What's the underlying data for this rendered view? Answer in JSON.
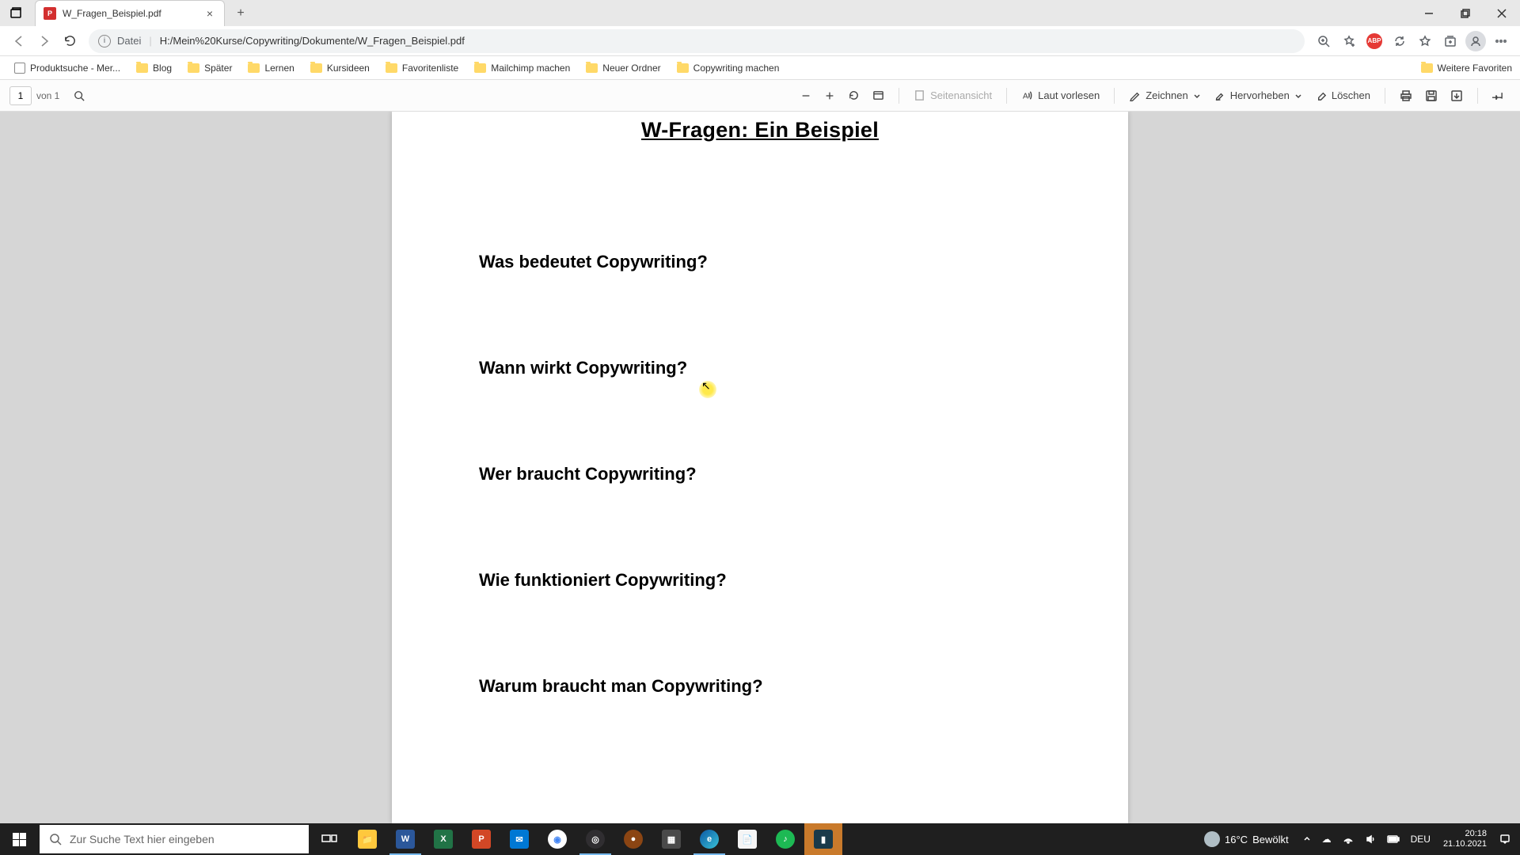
{
  "tab": {
    "title": "W_Fragen_Beispiel.pdf"
  },
  "url": {
    "scheme_label": "Datei",
    "path": "H:/Mein%20Kurse/Copywriting/Dokumente/W_Fragen_Beispiel.pdf"
  },
  "bookmarks": [
    {
      "label": "Produktsuche - Mer...",
      "icon": "page"
    },
    {
      "label": "Blog",
      "icon": "folder"
    },
    {
      "label": "Später",
      "icon": "folder"
    },
    {
      "label": "Lernen",
      "icon": "folder"
    },
    {
      "label": "Kursideen",
      "icon": "folder"
    },
    {
      "label": "Favoritenliste",
      "icon": "folder"
    },
    {
      "label": "Mailchimp machen",
      "icon": "folder"
    },
    {
      "label": "Neuer Ordner",
      "icon": "folder"
    },
    {
      "label": "Copywriting machen",
      "icon": "folder"
    }
  ],
  "more_bookmarks_label": "Weitere Favoriten",
  "pdf_toolbar": {
    "page_current": "1",
    "page_of": "von 1",
    "page_view": "Seitenansicht",
    "read_aloud": "Laut vorlesen",
    "draw": "Zeichnen",
    "highlight": "Hervorheben",
    "erase": "Löschen"
  },
  "document": {
    "title": "W-Fragen: Ein Beispiel",
    "questions": [
      "Was bedeutet Copywriting?",
      "Wann wirkt Copywriting?",
      "Wer braucht Copywriting?",
      "Wie funktioniert Copywriting?",
      "Warum braucht man Copywriting?"
    ]
  },
  "search_placeholder": "Zur Suche Text hier eingeben",
  "weather": {
    "temp": "16°C",
    "desc": "Bewölkt"
  },
  "keyboard": "DEU",
  "datetime": {
    "time": "20:18",
    "date": "21.10.2021"
  }
}
